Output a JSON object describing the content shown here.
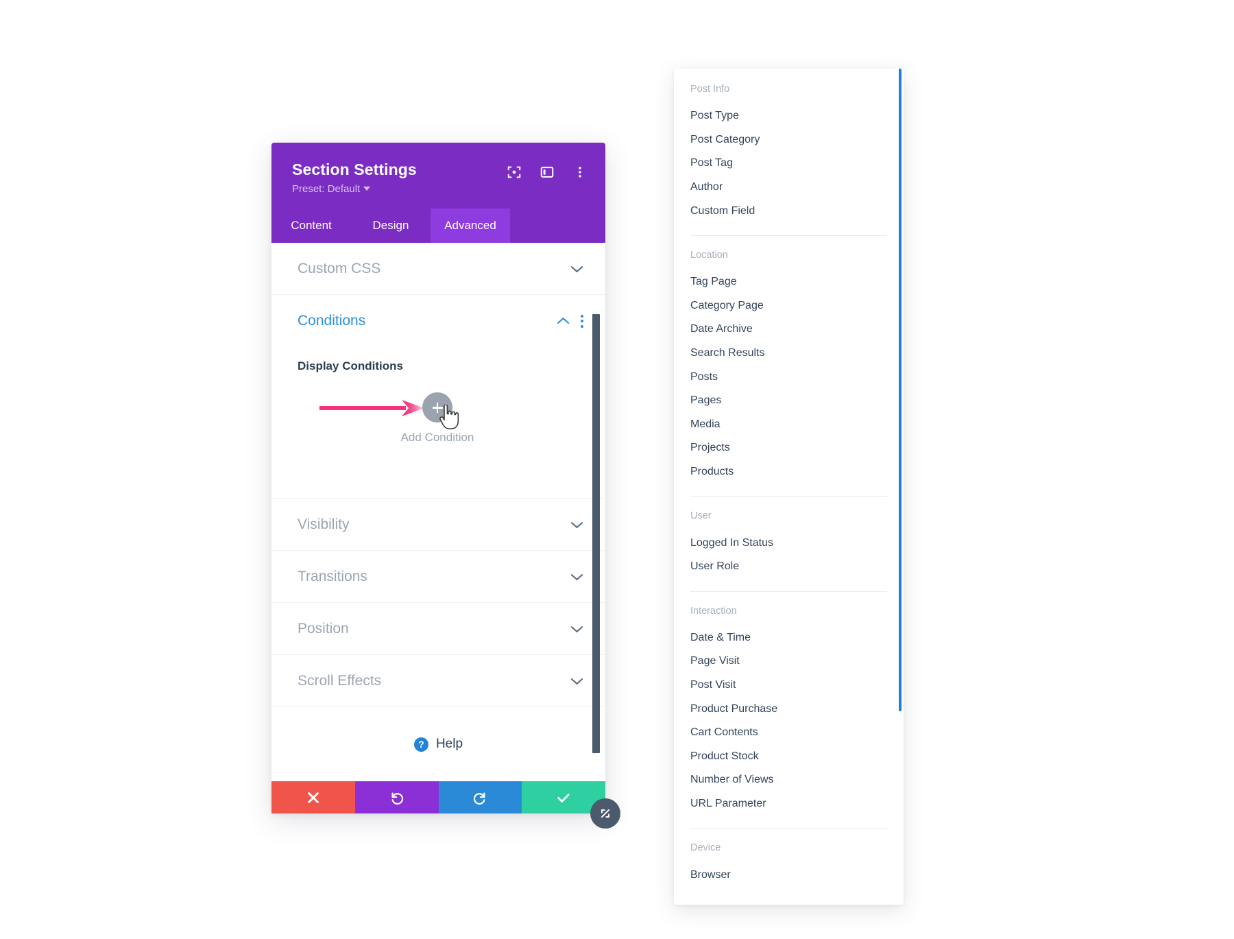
{
  "settings_modal": {
    "title": "Section Settings",
    "preset_label": "Preset: Default",
    "header_icons": [
      {
        "name": "focus-target-icon",
        "label": "Focus"
      },
      {
        "name": "layout-panel-icon",
        "label": "Layout"
      },
      {
        "name": "more-options-icon",
        "label": "More Options"
      }
    ],
    "tabs": [
      {
        "label": "Content",
        "active": false
      },
      {
        "label": "Design",
        "active": false
      },
      {
        "label": "Advanced",
        "active": true
      }
    ],
    "sections": [
      {
        "label": "Custom CSS",
        "state": "collapsed"
      },
      {
        "label": "Conditions",
        "state": "expanded"
      },
      {
        "label": "Visibility",
        "state": "collapsed"
      },
      {
        "label": "Transitions",
        "state": "collapsed"
      },
      {
        "label": "Position",
        "state": "collapsed"
      },
      {
        "label": "Scroll Effects",
        "state": "collapsed"
      }
    ],
    "conditions": {
      "field_label": "Display Conditions",
      "add_button_label": "Add Condition",
      "add_button_glyph": "+"
    },
    "help": {
      "label": "Help",
      "icon_glyph": "?"
    },
    "actions": [
      {
        "name": "discard-button",
        "icon": "close-icon",
        "color": "#F0544B"
      },
      {
        "name": "undo-button",
        "icon": "undo-icon",
        "color": "#8B2FD6"
      },
      {
        "name": "redo-button",
        "icon": "redo-icon",
        "color": "#2B8AD8"
      },
      {
        "name": "save-button",
        "icon": "check-icon",
        "color": "#2ECFA0"
      }
    ],
    "resize_handle_icon": "resize-diagonal-icon"
  },
  "condition_dropdown": {
    "groups": [
      {
        "title": "Post Info",
        "items": [
          "Post Type",
          "Post Category",
          "Post Tag",
          "Author",
          "Custom Field"
        ]
      },
      {
        "title": "Location",
        "items": [
          "Tag Page",
          "Category Page",
          "Date Archive",
          "Search Results",
          "Posts",
          "Pages",
          "Media",
          "Projects",
          "Products"
        ]
      },
      {
        "title": "User",
        "items": [
          "Logged In Status",
          "User Role"
        ]
      },
      {
        "title": "Interaction",
        "items": [
          "Date & Time",
          "Page Visit",
          "Post Visit",
          "Product Purchase",
          "Cart Contents",
          "Product Stock",
          "Number of Views",
          "URL Parameter"
        ]
      },
      {
        "title": "Device",
        "items": [
          "Browser"
        ]
      }
    ]
  },
  "annotation": {
    "arrow_color": "#F6317F",
    "arrow_target": "add-condition-button"
  },
  "colors": {
    "header_purple": "#7B2CC2",
    "tab_active_purple": "#8E3BE0",
    "accent_blue": "#2A8FE0",
    "scrollbar_dark": "#4C5A6E",
    "dropdown_scrollbar_blue": "#1E7FE0",
    "muted_text": "#9AA5B1"
  }
}
